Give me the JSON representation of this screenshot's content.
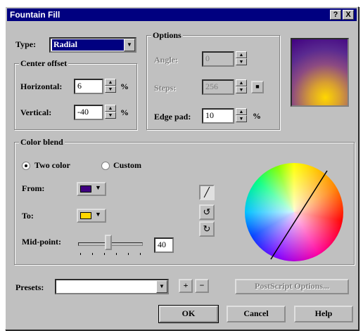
{
  "window": {
    "title": "Fountain Fill",
    "help_button": "?",
    "close_button": "X"
  },
  "type_select": {
    "label": "Type:",
    "value": "Radial"
  },
  "center_offset": {
    "group_label": "Center offset",
    "horizontal_label": "Horizontal:",
    "horizontal_value": "6",
    "vertical_label": "Vertical:",
    "vertical_value": "-40",
    "unit": "%"
  },
  "options": {
    "group_label": "Options",
    "angle_label": "Angle:",
    "angle_value": "0",
    "steps_label": "Steps:",
    "steps_value": "256",
    "edge_label": "Edge pad:",
    "edge_value": "10",
    "unit": "%"
  },
  "color_blend": {
    "group_label": "Color blend",
    "two_color_label": "Two color",
    "custom_label": "Custom",
    "from_label": "From:",
    "to_label": "To:",
    "from_color": "#400080",
    "to_color": "#ffd700",
    "midpoint_label": "Mid-point:",
    "midpoint_value": "40"
  },
  "preset": {
    "label": "Presets:",
    "value": ""
  },
  "buttons": {
    "postscript": "PostScript Options...",
    "ok": "OK",
    "cancel": "Cancel",
    "help": "Help",
    "add": "+",
    "remove": "−"
  },
  "icons": {
    "direct_path": "╱",
    "ccw_path": "↺",
    "cw_path": "↻",
    "combo_arrow": "▼",
    "spin_up": "▲",
    "spin_down": "▼",
    "lock": "■"
  }
}
